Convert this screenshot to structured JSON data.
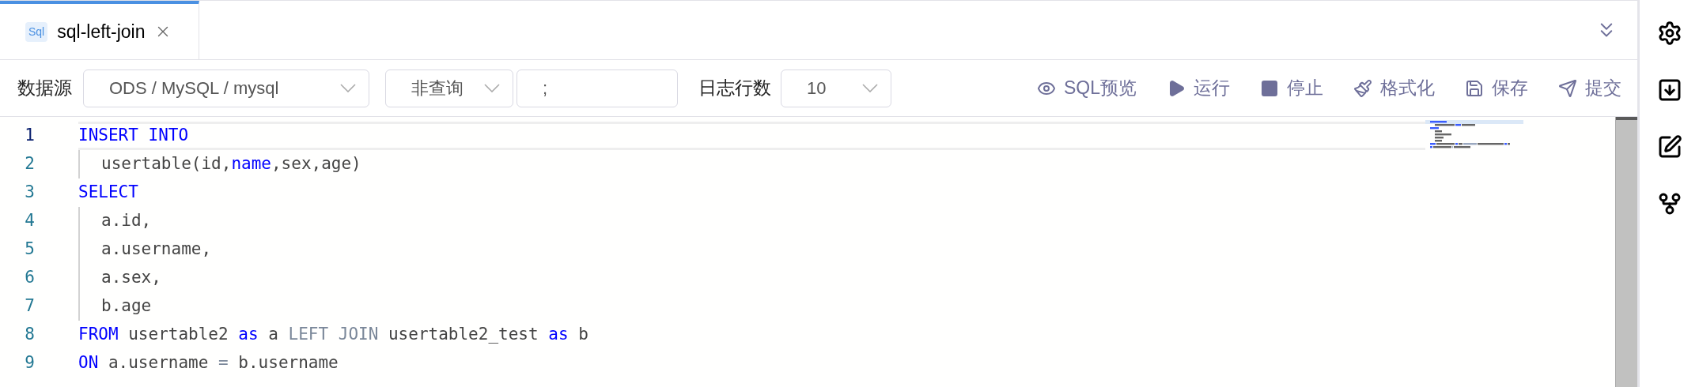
{
  "tabs": [
    {
      "icon_text": "Sql",
      "title": "sql-left-join",
      "selected": true
    }
  ],
  "toolbar": {
    "datasource_label": "数据源",
    "datasource": "ODS / MySQL / mysql",
    "query_type": "非查询",
    "delimiter": ";",
    "log_rows_label": "日志行数",
    "log_rows": "10",
    "actions": [
      {
        "kind": "eye",
        "label": "SQL预览"
      },
      {
        "kind": "play",
        "label": "运行"
      },
      {
        "kind": "stop",
        "label": "停止"
      },
      {
        "kind": "brush",
        "label": "格式化"
      },
      {
        "kind": "save",
        "label": "保存"
      },
      {
        "kind": "send",
        "label": "提交"
      }
    ]
  },
  "editor": {
    "lines": [
      {
        "number": "1",
        "current": true,
        "indented": false,
        "tokens": [
          {
            "kind": "keyword",
            "text": "INSERT INTO"
          }
        ]
      },
      {
        "number": "2",
        "current": false,
        "indented": true,
        "tokens": [
          {
            "kind": "plain",
            "text": "usertable(id,"
          },
          {
            "kind": "keyword",
            "text": "name"
          },
          {
            "kind": "plain",
            "text": ",sex,age)"
          }
        ]
      },
      {
        "number": "3",
        "current": false,
        "indented": false,
        "tokens": [
          {
            "kind": "keyword",
            "text": "SELECT"
          }
        ]
      },
      {
        "number": "4",
        "current": false,
        "indented": true,
        "tokens": [
          {
            "kind": "plain",
            "text": "a.id,"
          }
        ]
      },
      {
        "number": "5",
        "current": false,
        "indented": true,
        "tokens": [
          {
            "kind": "plain",
            "text": "a.username,"
          }
        ]
      },
      {
        "number": "6",
        "current": false,
        "indented": true,
        "tokens": [
          {
            "kind": "plain",
            "text": "a.sex,"
          }
        ]
      },
      {
        "number": "7",
        "current": false,
        "indented": true,
        "tokens": [
          {
            "kind": "plain",
            "text": "b.age"
          }
        ]
      },
      {
        "number": "8",
        "current": false,
        "indented": false,
        "tokens": [
          {
            "kind": "keyword",
            "text": "FROM"
          },
          {
            "kind": "plain",
            "text": " usertable2 "
          },
          {
            "kind": "keyword",
            "text": "as"
          },
          {
            "kind": "plain",
            "text": " a "
          },
          {
            "kind": "join",
            "text": "LEFT JOIN"
          },
          {
            "kind": "plain",
            "text": " usertable2_test "
          },
          {
            "kind": "keyword",
            "text": "as"
          },
          {
            "kind": "plain",
            "text": " b"
          }
        ]
      },
      {
        "number": "9",
        "current": false,
        "indented": false,
        "tokens": [
          {
            "kind": "keyword",
            "text": "ON"
          },
          {
            "kind": "plain",
            "text": " a.username "
          },
          {
            "kind": "join",
            "text": "="
          },
          {
            "kind": "plain",
            "text": " b.username"
          }
        ]
      }
    ]
  },
  "side_icons": [
    {
      "kind": "gear"
    },
    {
      "kind": "download"
    },
    {
      "kind": "edit"
    },
    {
      "kind": "branch"
    }
  ]
}
